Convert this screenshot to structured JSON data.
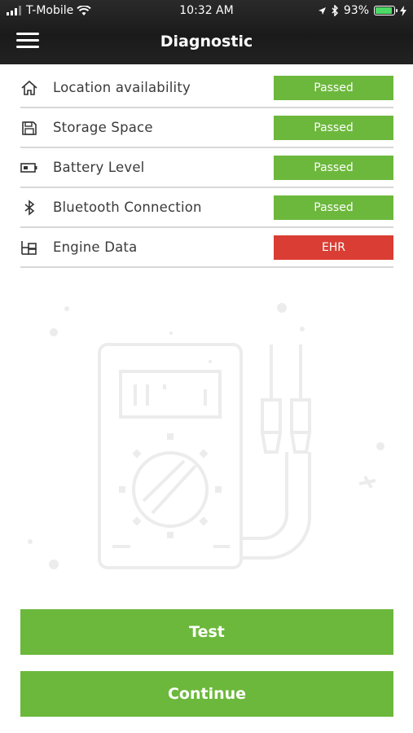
{
  "status_bar": {
    "carrier": "T-Mobile",
    "time": "10:32 AM",
    "battery_percent": "93%"
  },
  "header": {
    "title": "Diagnostic",
    "menu_icon": "hamburger-menu-icon"
  },
  "checks": [
    {
      "label": "Location availability",
      "status": "Passed",
      "state": "pass",
      "icon": "home-icon"
    },
    {
      "label": "Storage Space",
      "status": "Passed",
      "state": "pass",
      "icon": "floppy-disk-icon"
    },
    {
      "label": "Battery Level",
      "status": "Passed",
      "state": "pass",
      "icon": "battery-icon"
    },
    {
      "label": "Bluetooth Connection",
      "status": "Passed",
      "state": "pass",
      "icon": "bluetooth-icon"
    },
    {
      "label": "Engine Data",
      "status": "EHR",
      "state": "fail",
      "icon": "engine-data-icon"
    }
  ],
  "buttons": {
    "test": "Test",
    "continue": "Continue"
  },
  "colors": {
    "pass": "#6cb83c",
    "fail": "#d93d33",
    "header_bg": "#1e1e1e"
  }
}
